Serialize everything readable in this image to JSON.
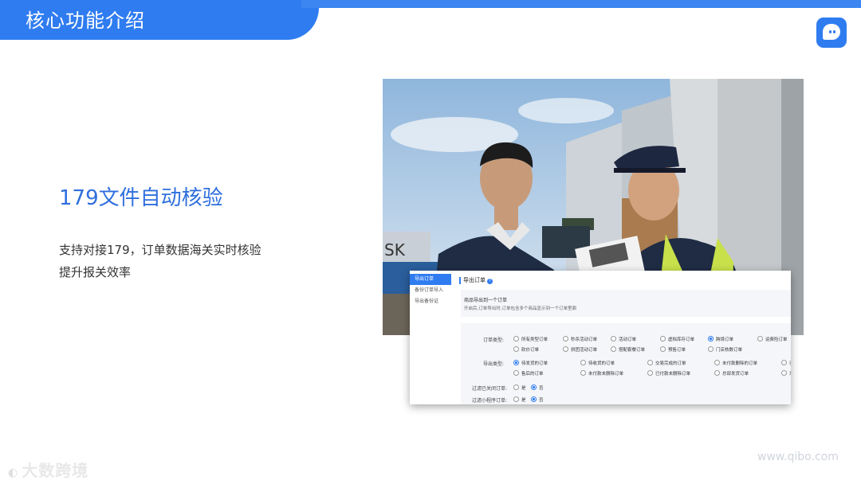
{
  "header": {
    "section_title": "核心功能介绍"
  },
  "feature": {
    "title": "179文件自动核验",
    "desc_line1": "支持对接179，订单数据海关实时核验",
    "desc_line2": "提升报关效率"
  },
  "photo": {
    "container_text": "SK"
  },
  "panel": {
    "sidebar": [
      "导出订单",
      "备份订单导入",
      "导出备份证"
    ],
    "title": "导出订单",
    "help_icon": "?",
    "info_line1": "商品导出到一个订单",
    "info_line2": "开启后,订单导出时,订单包含多个商品显示到一个订单里面",
    "order_type": {
      "label": "订单类型:",
      "options": [
        "所有类型订单",
        "秒杀活动订单",
        "活动订单",
        "虚拟库存订单",
        "跨境订单",
        "运费险订单",
        "砍价订单",
        "拼团活动订单",
        "搭配套餐订单",
        "预售订单",
        "门店核数订单"
      ],
      "selected": "跨境订单"
    },
    "export_type": {
      "label": "导出类型:",
      "options": [
        "待发货的订单",
        "待收货的订单",
        "交易完成的订单",
        "未付款删除的订单",
        "已",
        "售后的订单",
        "未付款未删除订单",
        "已付款未删除订单",
        "总部发货订单",
        "来"
      ],
      "selected": "待发货的订单"
    },
    "filter_closed": {
      "label": "过滤已关闭订单:",
      "yes": "是",
      "no": "否",
      "selected": "否"
    },
    "filter_mini": {
      "label": "过滤小程序订单:",
      "yes": "是",
      "no": "否",
      "selected": "否"
    }
  },
  "footer": {
    "brand": "大数跨境",
    "url": "www.qibo.com"
  },
  "colors": {
    "accent": "#2f7cf0",
    "title_blue": "#2f6fde"
  }
}
